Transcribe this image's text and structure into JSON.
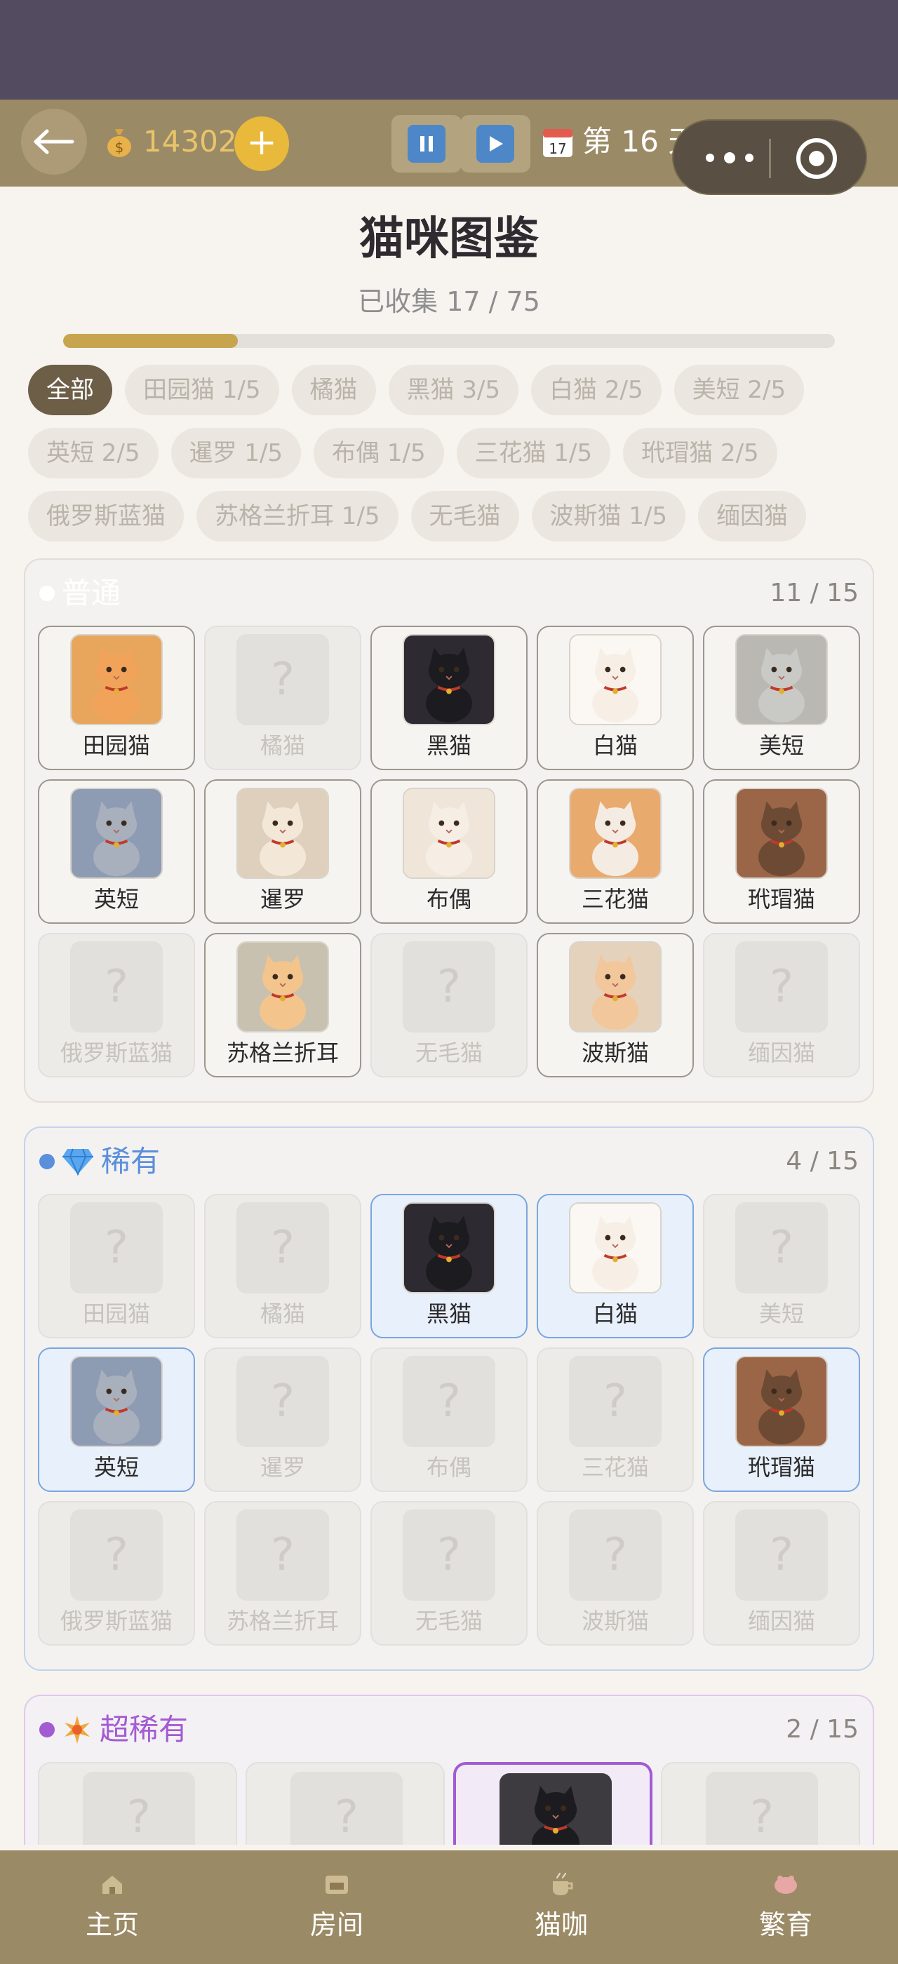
{
  "header": {
    "coins": "14302",
    "add_label": "+",
    "day": "第 16 天"
  },
  "page": {
    "title": "猫咪图鉴",
    "collected": "已收集 17 / 75",
    "progress": 0.2267
  },
  "filters": [
    [
      "全部",
      "田园猫 1/5",
      "橘猫",
      "黑猫 3/5",
      "白猫 2/5",
      "美短 2/5"
    ],
    [
      "英短 2/5",
      "暹罗 1/5",
      "布偶 1/5",
      "三花猫 1/5",
      "玳瑁猫 2/5"
    ],
    [
      "俄罗斯蓝猫",
      "苏格兰折耳 1/5",
      "无毛猫",
      "波斯猫 1/5",
      "缅因猫"
    ]
  ],
  "sections": {
    "common": {
      "label": "普通",
      "count": "11 / 15",
      "color": "#ffffff",
      "cats": [
        {
          "name": "田园猫",
          "unlocked": true,
          "bg": "#e8a55c",
          "fur": "#f2a35a"
        },
        {
          "name": "橘猫",
          "unlocked": false
        },
        {
          "name": "黑猫",
          "unlocked": true,
          "bg": "#2d2b31",
          "fur": "#1c1b1f"
        },
        {
          "name": "白猫",
          "unlocked": true,
          "bg": "#fbf8f4",
          "fur": "#f7efe6"
        },
        {
          "name": "美短",
          "unlocked": true,
          "bg": "#b9b8b3",
          "fur": "#c9c9c6"
        },
        {
          "name": "英短",
          "unlocked": true,
          "bg": "#8d9bb3",
          "fur": "#a9b0bd"
        },
        {
          "name": "暹罗",
          "unlocked": true,
          "bg": "#dfd0bd",
          "fur": "#f3e8d8"
        },
        {
          "name": "布偶",
          "unlocked": true,
          "bg": "#efe5d9",
          "fur": "#f6eee4"
        },
        {
          "name": "三花猫",
          "unlocked": true,
          "bg": "#e9aa6e",
          "fur": "#f4ece2"
        },
        {
          "name": "玳瑁猫",
          "unlocked": true,
          "bg": "#9a6647",
          "fur": "#6d4a33"
        },
        {
          "name": "俄罗斯蓝猫",
          "unlocked": false
        },
        {
          "name": "苏格兰折耳",
          "unlocked": true,
          "bg": "#c9c1b0",
          "fur": "#f4c48d"
        },
        {
          "name": "无毛猫",
          "unlocked": false
        },
        {
          "name": "波斯猫",
          "unlocked": true,
          "bg": "#e4d2bd",
          "fur": "#f1c79b"
        },
        {
          "name": "缅因猫",
          "unlocked": false
        }
      ]
    },
    "rare": {
      "label": "稀有",
      "count": "4 / 15",
      "color": "#5b8fdc",
      "cats": [
        {
          "name": "田园猫",
          "unlocked": false
        },
        {
          "name": "橘猫",
          "unlocked": false
        },
        {
          "name": "黑猫",
          "unlocked": true,
          "bg": "#2d2b31",
          "fur": "#1c1b1f"
        },
        {
          "name": "白猫",
          "unlocked": true,
          "bg": "#fbf8f4",
          "fur": "#f7efe6"
        },
        {
          "name": "美短",
          "unlocked": false
        },
        {
          "name": "英短",
          "unlocked": true,
          "bg": "#8d9bb3",
          "fur": "#a9b0bd"
        },
        {
          "name": "暹罗",
          "unlocked": false
        },
        {
          "name": "布偶",
          "unlocked": false
        },
        {
          "name": "三花猫",
          "unlocked": false
        },
        {
          "name": "玳瑁猫",
          "unlocked": true,
          "bg": "#9a6647",
          "fur": "#6d4a33"
        },
        {
          "name": "俄罗斯蓝猫",
          "unlocked": false
        },
        {
          "name": "苏格兰折耳",
          "unlocked": false
        },
        {
          "name": "无毛猫",
          "unlocked": false
        },
        {
          "name": "波斯猫",
          "unlocked": false
        },
        {
          "name": "缅因猫",
          "unlocked": false
        }
      ]
    },
    "super_rare": {
      "label": "超稀有",
      "count": "2 / 15",
      "color": "#a35bd2",
      "cats": [
        {
          "unlocked": false
        },
        {
          "unlocked": false
        },
        {
          "unlocked": true
        },
        {
          "unlocked": false
        }
      ]
    }
  },
  "nav": [
    "主页",
    "房间",
    "猫咖",
    "繁育"
  ]
}
